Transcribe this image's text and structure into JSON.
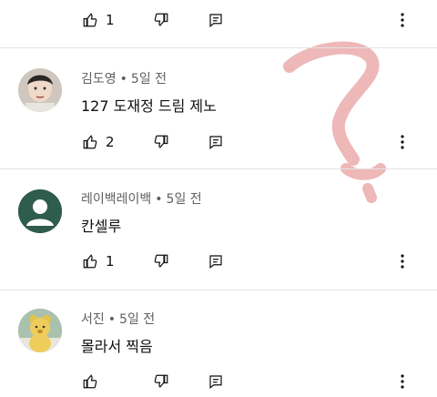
{
  "comments": [
    {
      "author": "",
      "time": "",
      "text": "",
      "likes": "1",
      "avatar_icon": "profile-photo"
    },
    {
      "author": "김도영",
      "time": "5일 전",
      "text": "127 도재정 드림 제노",
      "likes": "2",
      "avatar_icon": "profile-photo-person"
    },
    {
      "author": "레이백레이백",
      "time": "5일 전",
      "text": "칸셀루",
      "likes": "1",
      "avatar_icon": "default-avatar-icon"
    },
    {
      "author": "서진",
      "time": "5일 전",
      "text": "몰라서 찍음",
      "likes": "",
      "avatar_icon": "profile-photo-teddy-bear"
    }
  ],
  "meta_separator": "•",
  "colors": {
    "text": "#0f0f0f",
    "meta": "#606060",
    "divider": "#e3e3e3",
    "default_avatar_bg": "#2e5c4d",
    "scribble": "#e8a0a0"
  },
  "icons": [
    "thumbs-up-icon",
    "thumbs-down-icon",
    "reply-icon",
    "more-vert-icon"
  ]
}
